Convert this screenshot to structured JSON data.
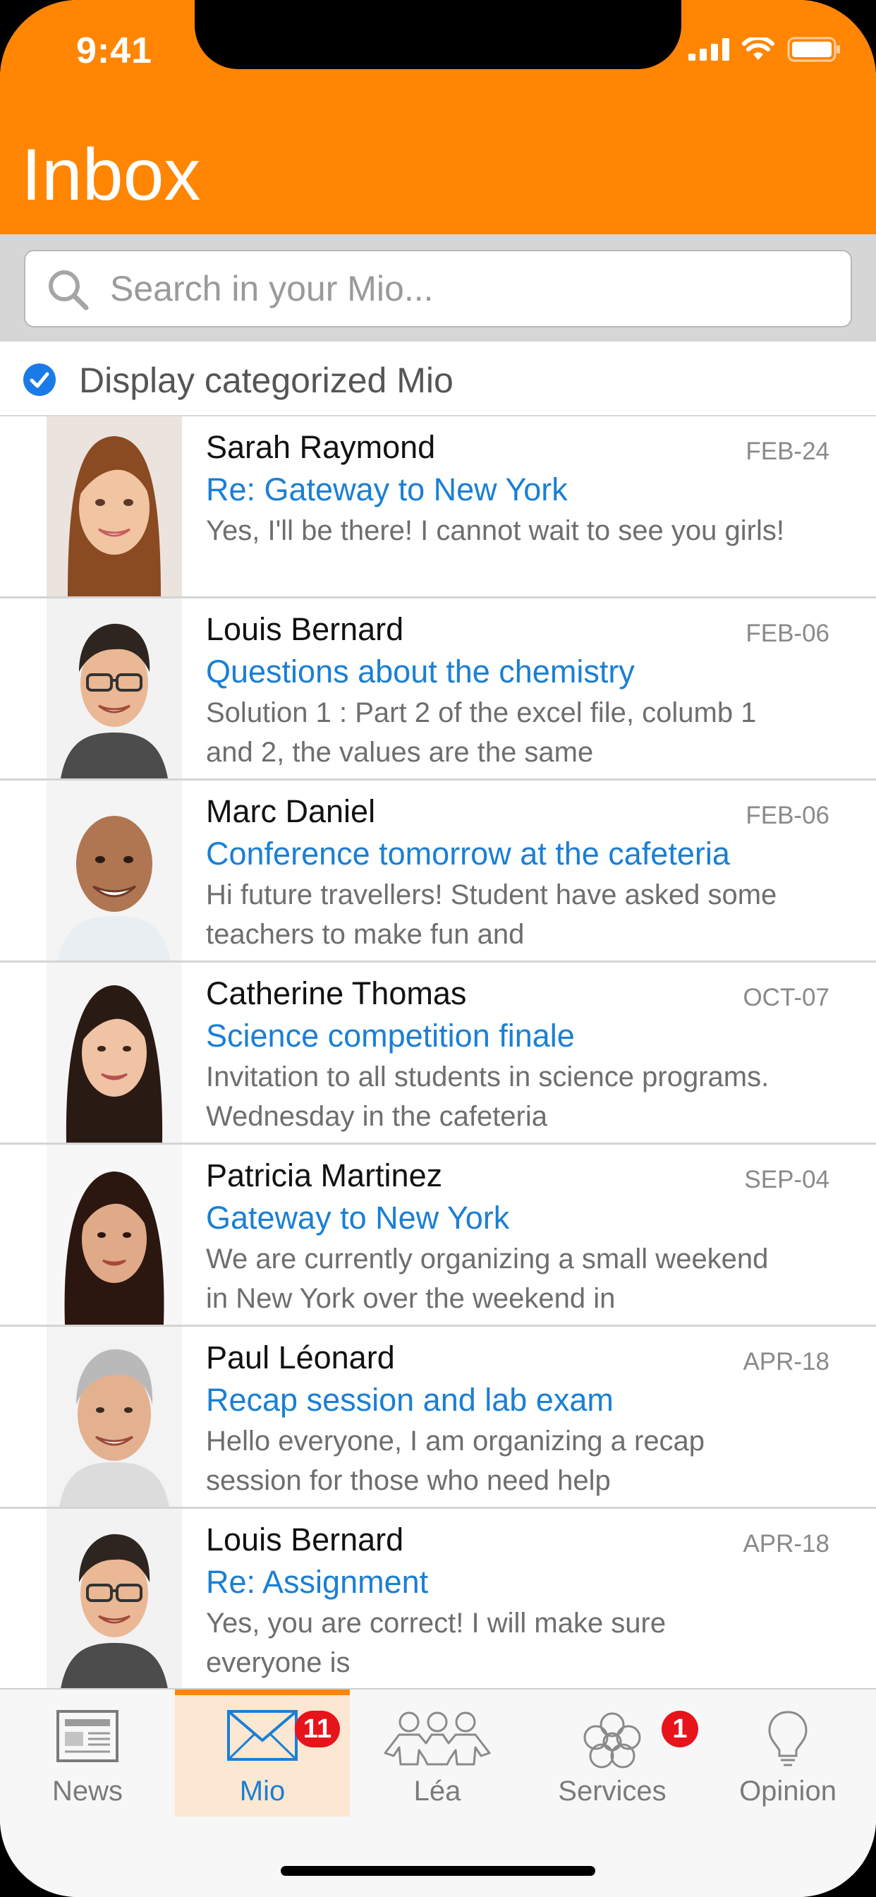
{
  "status": {
    "time": "9:41"
  },
  "header": {
    "title": "Inbox"
  },
  "search": {
    "placeholder": "Search in your Mio..."
  },
  "filter": {
    "label": "Display categorized Mio",
    "checked": true
  },
  "messages": [
    {
      "sender": "Sarah Raymond",
      "date": "FEB-24",
      "subject": "Re: Gateway to New York",
      "preview": "Yes, I'll be there! I cannot wait to see you girls!"
    },
    {
      "sender": "Louis Bernard",
      "date": "FEB-06",
      "subject": "Questions about the chemistry",
      "preview": "Solution 1 : Part 2 of the excel file, columb 1 and 2, the values are the same"
    },
    {
      "sender": "Marc Daniel",
      "date": "FEB-06",
      "subject": "Conference tomorrow at the cafeteria",
      "preview": "Hi future travellers! Student have asked some teachers to make fun and"
    },
    {
      "sender": "Catherine Thomas",
      "date": "OCT-07",
      "subject": "Science competition finale",
      "preview": "Invitation to all students in science programs. Wednesday in the cafeteria"
    },
    {
      "sender": "Patricia Martinez",
      "date": "SEP-04",
      "subject": "Gateway to New York",
      "preview": "We are currently organizing a small weekend in New York over the weekend in"
    },
    {
      "sender": "Paul Léonard",
      "date": "APR-18",
      "subject": "Recap session and lab exam",
      "preview": "Hello everyone, I am organizing a recap session for those who need help"
    },
    {
      "sender": "Louis Bernard",
      "date": "APR-18",
      "subject": "Re: Assignment",
      "preview": "Yes, you are correct! I will make sure everyone is"
    }
  ],
  "tabs": [
    {
      "label": "News",
      "icon": "newspaper-icon",
      "active": false
    },
    {
      "label": "Mio",
      "icon": "envelope-icon",
      "active": true,
      "badge": "11"
    },
    {
      "label": "Léa",
      "icon": "people-icon",
      "active": false
    },
    {
      "label": "Services",
      "icon": "flower-icon",
      "active": false,
      "badge": "1"
    },
    {
      "label": "Opinion",
      "icon": "lightbulb-icon",
      "active": false
    }
  ],
  "colors": {
    "accent": "#ff8503",
    "link": "#1b7fd4",
    "badge": "#e8141b"
  }
}
